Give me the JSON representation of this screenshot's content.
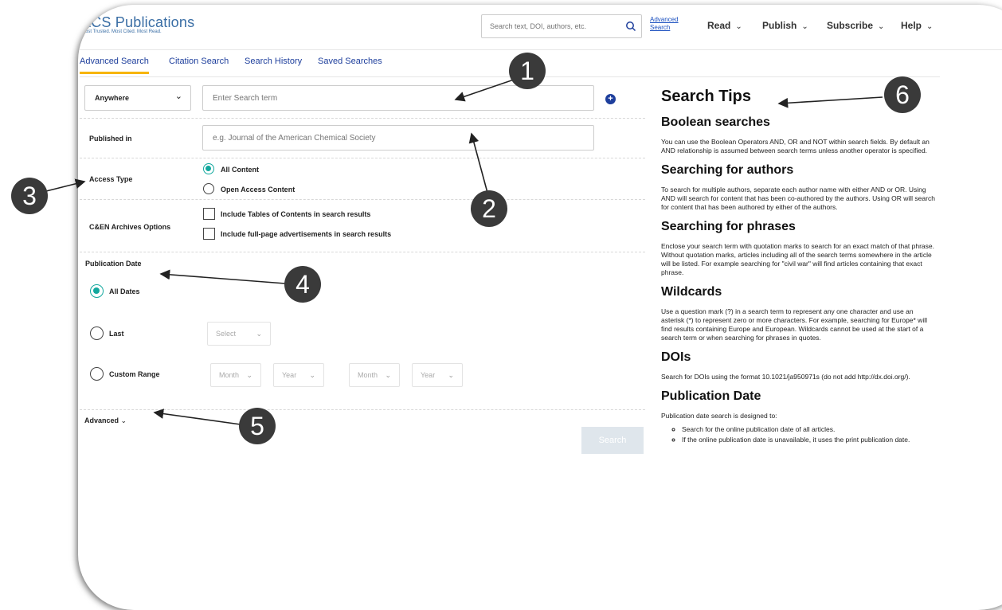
{
  "logo": {
    "brand": "ACS Publications",
    "tagline": "Most Trusted. Most Cited. Most Read."
  },
  "header": {
    "search_placeholder": "Search text, DOI, authors, etc.",
    "advanced_link_line1": "Advanced",
    "advanced_link_line2": "Search",
    "nav": [
      "Read",
      "Publish",
      "Subscribe",
      "Help"
    ]
  },
  "tabs": [
    "Advanced Search",
    "Citation Search",
    "Search History",
    "Saved Searches"
  ],
  "form": {
    "field_select": "Anywhere",
    "search_placeholder": "Enter Search term",
    "published_in_label": "Published in",
    "published_in_placeholder": "e.g. Journal of the American Chemical Society",
    "access_type_label": "Access Type",
    "access_options": [
      "All Content",
      "Open Access Content"
    ],
    "archives_label": "C&EN Archives Options",
    "archives_options": [
      "Include Tables of Contents in search results",
      "Include full-page advertisements in search results"
    ],
    "pub_date_label": "Publication Date",
    "date_options": [
      "All Dates",
      "Last",
      "Custom Range"
    ],
    "last_select": "Select",
    "range_selects": [
      "Month",
      "Year",
      "Month",
      "Year"
    ],
    "advanced_toggle": "Advanced",
    "search_button": "Search"
  },
  "tips": {
    "title": "Search Tips",
    "sections": [
      {
        "heading": "Boolean searches",
        "body": "You can use the Boolean Operators AND, OR and NOT within search fields. By default an AND relationship is assumed between search terms unless another operator is specified."
      },
      {
        "heading": "Searching for authors",
        "body": "To search for multiple authors, separate each author name with either AND or OR. Using AND will search for content that has been co-authored by the authors. Using OR will search for content that has been authored by either of the authors."
      },
      {
        "heading": "Searching for phrases",
        "body": "Enclose your search term with quotation marks to search for an exact match of that phrase. Without quotation marks, articles including all of the search terms somewhere in the article will be listed. For example searching for \"civil war\" will find articles containing that exact phrase."
      },
      {
        "heading": "Wildcards",
        "body": "Use a question mark (?) in a search term to represent any one character and use an asterisk (*) to represent zero or more characters. For example, searching for Europe* will find results containing Europe and European. Wildcards cannot be used at the start of a search term or when searching for phrases in quotes."
      },
      {
        "heading": "DOIs",
        "body": "Search for DOIs using the format 10.1021/ja950971s (do not add http://dx.doi.org/)."
      },
      {
        "heading": "Publication Date",
        "body": "Publication date search is designed to:"
      }
    ],
    "pub_date_bullets": [
      "Search for the online publication date of all articles.",
      "If the online publication date is unavailable, it uses the print publication date."
    ]
  },
  "callouts": [
    "1",
    "2",
    "3",
    "4",
    "5",
    "6"
  ],
  "colors": {
    "accent": "#13a89e",
    "link": "#1d3e9c",
    "tab_underline": "#f7b500",
    "badge": "#3a3a3a"
  }
}
